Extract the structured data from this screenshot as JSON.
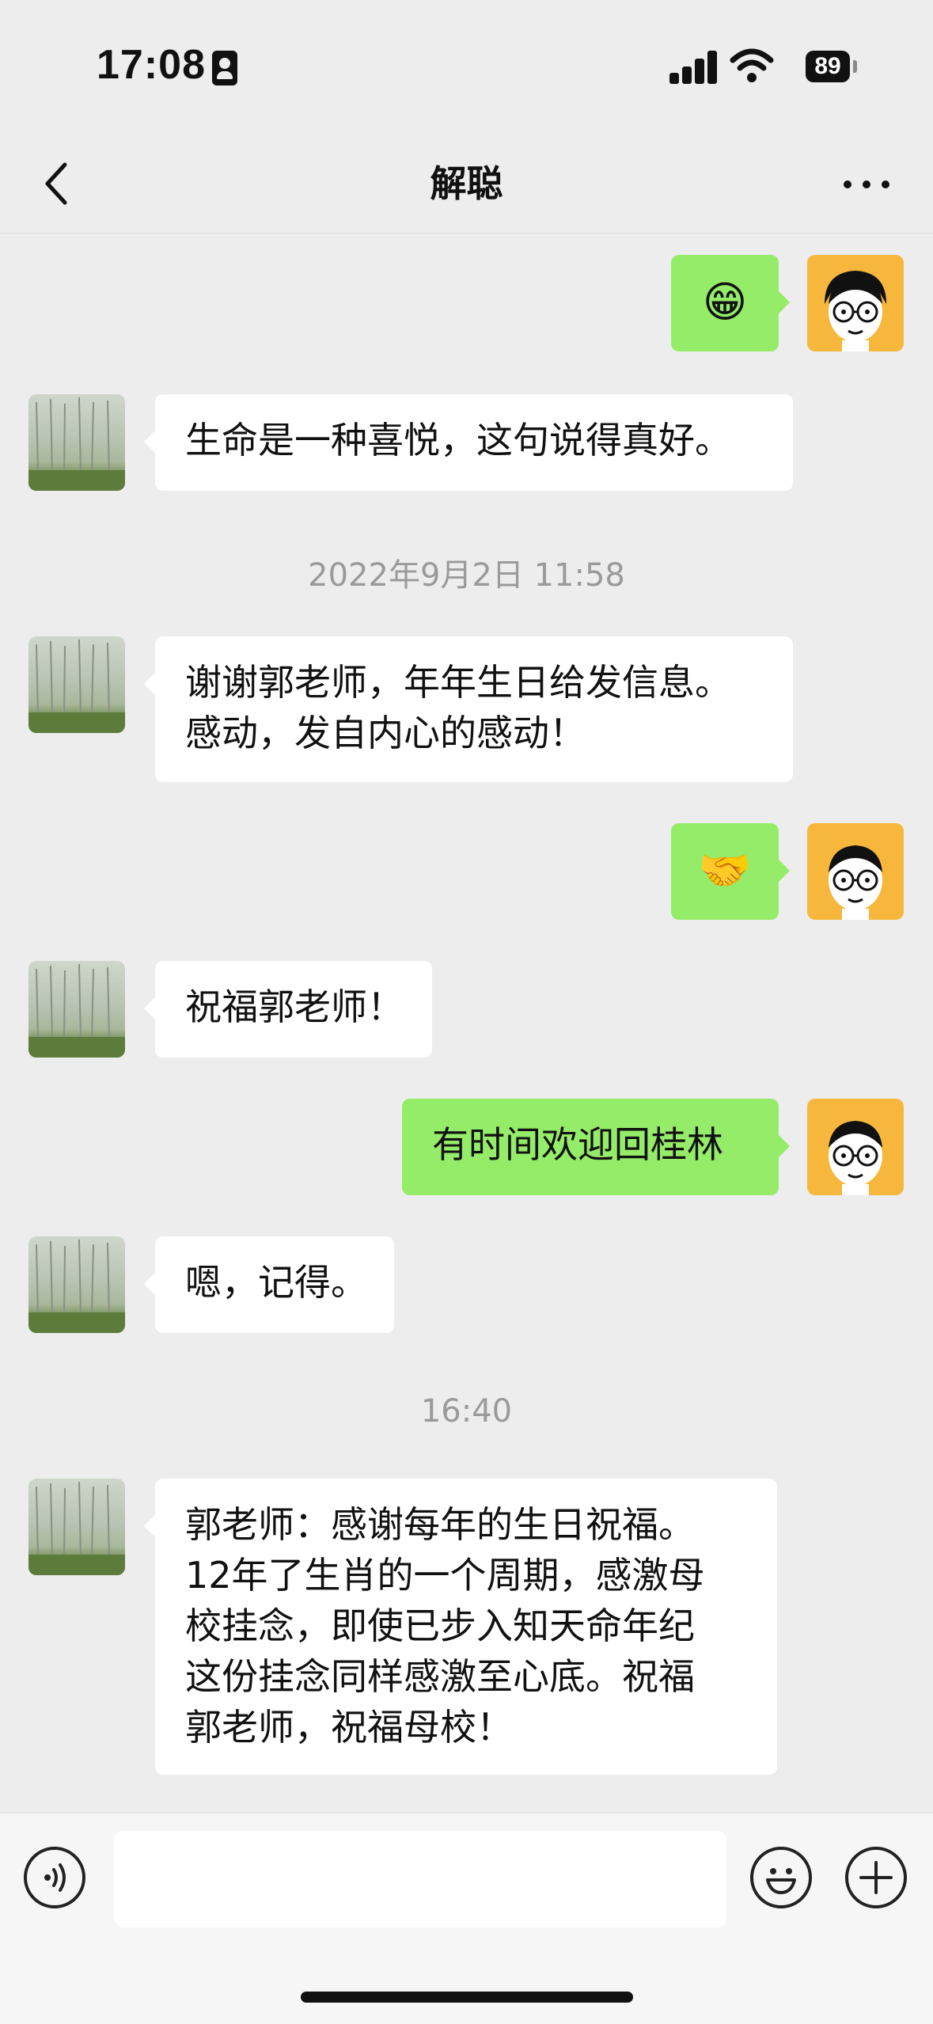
{
  "status_bar": {
    "time": "17:08",
    "battery": "89"
  },
  "nav": {
    "title": "解聪"
  },
  "messages": [
    {
      "side": "out",
      "text": "😁"
    },
    {
      "side": "in",
      "text": "生命是一种喜悦，这句说得真好。"
    },
    {
      "type": "timestamp",
      "text": "2022年9月2日 11:58"
    },
    {
      "side": "in",
      "text": "谢谢郭老师，年年生日给发信息。\n感动，发自内心的感动！"
    },
    {
      "side": "out",
      "text": "🤝"
    },
    {
      "side": "in",
      "text": "祝福郭老师！"
    },
    {
      "side": "out",
      "text": "有时间欢迎回桂林"
    },
    {
      "side": "in",
      "text": "嗯，记得。"
    },
    {
      "type": "timestamp",
      "text": "16:40"
    },
    {
      "side": "in",
      "text": "郭老师：感谢每年的生日祝福。\n12年了生肖的一个周期，感激母\n校挂念，即使已步入知天命年纪\n这份挂念同样感激至心底。祝福\n郭老师，祝福母校！"
    }
  ],
  "input": {
    "placeholder": ""
  },
  "colors": {
    "out_bubble": "#95ec69",
    "in_bubble": "#ffffff",
    "background": "#ededed"
  },
  "icons": [
    "back-icon",
    "more-icon",
    "voice-icon",
    "emoji-icon",
    "plus-icon"
  ]
}
